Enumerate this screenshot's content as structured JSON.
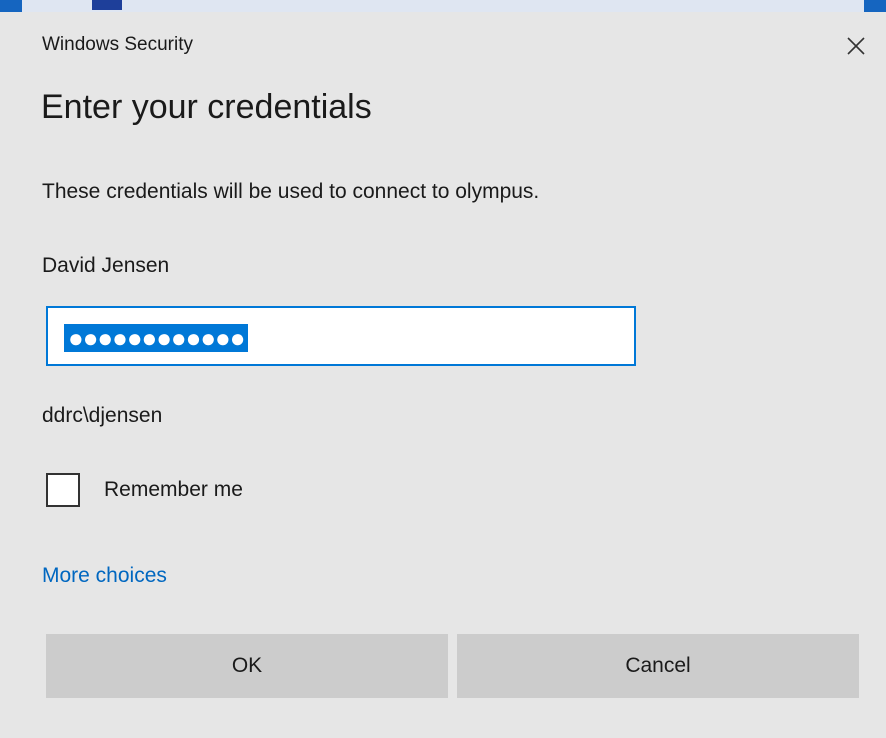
{
  "window": {
    "title": "Windows Security"
  },
  "dialog": {
    "heading": "Enter your credentials",
    "message": "These credentials will be used to connect to olympus.",
    "user_display_name": "David Jensen",
    "password": {
      "masked_value": "●●●●●●●●●●●●",
      "selected": true
    },
    "domain_user": "ddrc\\djensen",
    "remember_me": {
      "label": "Remember me",
      "checked": false
    },
    "more_choices_label": "More choices",
    "buttons": {
      "ok_label": "OK",
      "cancel_label": "Cancel"
    }
  },
  "colors": {
    "background": "#e6e6e6",
    "accent": "#0078d7",
    "link": "#0067c0",
    "button": "#cccccc"
  },
  "icons": {
    "close": "close-icon"
  }
}
